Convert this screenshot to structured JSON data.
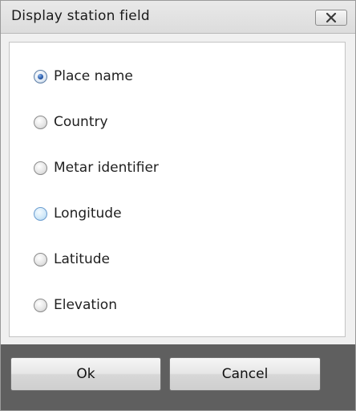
{
  "window": {
    "title": "Display station field"
  },
  "options": [
    {
      "label": "Place name",
      "selected": true
    },
    {
      "label": "Country",
      "selected": false
    },
    {
      "label": "Metar identifier",
      "selected": false
    },
    {
      "label": "Longitude",
      "selected": false,
      "hover": true
    },
    {
      "label": "Latitude",
      "selected": false
    },
    {
      "label": "Elevation",
      "selected": false
    }
  ],
  "buttons": {
    "ok_label": "Ok",
    "cancel_label": "Cancel"
  },
  "icons": {
    "close": "close-icon",
    "radio": "radio-button-icon"
  }
}
